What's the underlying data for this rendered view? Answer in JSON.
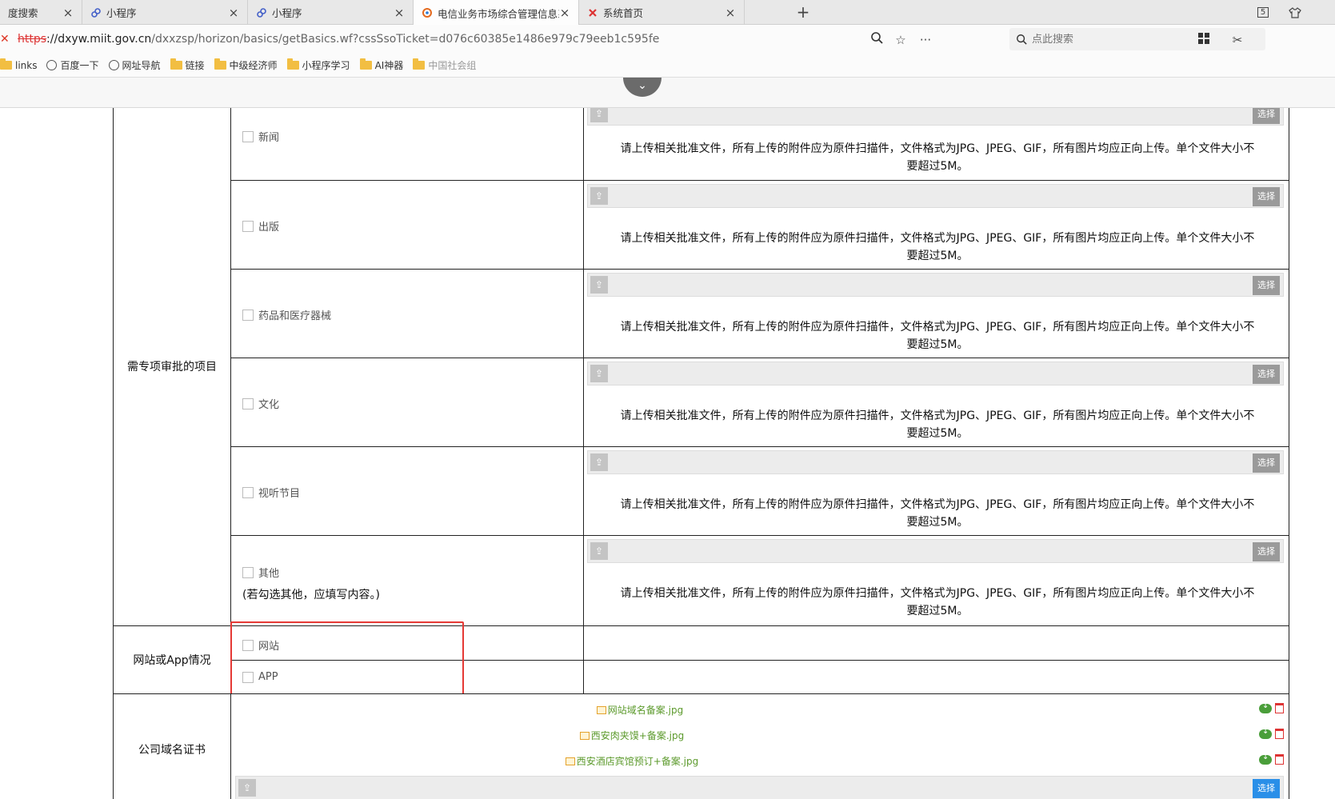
{
  "browser": {
    "tabs": [
      {
        "title": "度搜索",
        "icon": "paw-icon",
        "active": false
      },
      {
        "title": "小程序",
        "icon": "link-icon",
        "active": false
      },
      {
        "title": "小程序",
        "icon": "link-icon",
        "active": false
      },
      {
        "title": "电信业务市场综合管理信息系",
        "icon": "logo-icon",
        "active": true
      },
      {
        "title": "系统首页",
        "icon": "logo-red-icon",
        "active": false
      }
    ],
    "new_tab_label": "+",
    "window_badge": "5",
    "address": {
      "scheme": "https",
      "host": "://dxyw.miit.gov.cn",
      "path": "/dxxzsp/horizon/basics/getBasics.wf?cssSsoTicket=d076c60385e1486e979c79eeb1c595fe"
    },
    "search_placeholder": "点此搜索",
    "bookmarks": [
      {
        "label": "links",
        "icon": "folder"
      },
      {
        "label": "百度一下",
        "icon": "globe"
      },
      {
        "label": "网址导航",
        "icon": "globe"
      },
      {
        "label": "链接",
        "icon": "folder"
      },
      {
        "label": "中级经济师",
        "icon": "folder"
      },
      {
        "label": "小程序学习",
        "icon": "folder"
      },
      {
        "label": "AI神器",
        "icon": "folder"
      },
      {
        "label": "中国社会组",
        "icon": "folder"
      }
    ]
  },
  "form": {
    "section_special_label": "需专项审批的项目",
    "special_items": [
      {
        "label": "新闻"
      },
      {
        "label": "出版"
      },
      {
        "label": "药品和医疗器械"
      },
      {
        "label": "文化"
      },
      {
        "label": "视听节目"
      },
      {
        "label": "其他",
        "note": "(若勾选其他，应填写内容。)"
      }
    ],
    "upload_notice_line1": "请上传相关批准文件，所有上传的附件应为原件扫描件，文件格式为JPG、JPEG、GIF，所有图片均应正向上传。单个文件大小不",
    "upload_notice_line2": "要超过5M。",
    "pick_label": "选择",
    "section_site_label": "网站或App情况",
    "site_items": [
      {
        "label": "网站"
      },
      {
        "label": "APP"
      }
    ],
    "section_domain_label": "公司域名证书",
    "domain_files": [
      "网站域名备案.jpg",
      "西安肉夹馍+备案.jpg",
      "西安酒店宾馆预订+备案.jpg"
    ]
  },
  "colors": {
    "highlight": "#e53935",
    "link_green": "#5c9a2c",
    "pick_blue": "#2a8fe8"
  }
}
